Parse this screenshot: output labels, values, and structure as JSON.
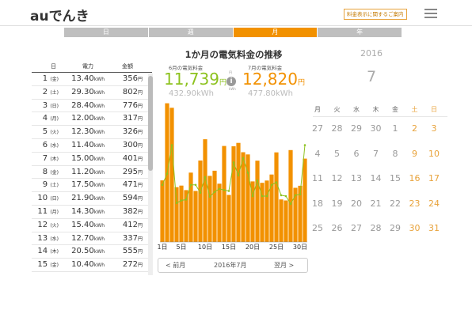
{
  "header": {
    "logo_au": "au",
    "logo_text": "でんき",
    "notice_label": "料金表示に関するご案内"
  },
  "tabs": [
    "日",
    "週",
    "月",
    "年"
  ],
  "table": {
    "headers": [
      "日",
      "電力",
      "金額"
    ],
    "rows": [
      {
        "day": "1",
        "wd": "(金)",
        "kwh": "13.40",
        "yen": "356"
      },
      {
        "day": "2",
        "wd": "(土)",
        "kwh": "29.30",
        "yen": "802"
      },
      {
        "day": "3",
        "wd": "(日)",
        "kwh": "28.40",
        "yen": "776"
      },
      {
        "day": "4",
        "wd": "(月)",
        "kwh": "12.00",
        "yen": "317"
      },
      {
        "day": "5",
        "wd": "(火)",
        "kwh": "12.30",
        "yen": "326"
      },
      {
        "day": "6",
        "wd": "(水)",
        "kwh": "11.40",
        "yen": "300"
      },
      {
        "day": "7",
        "wd": "(木)",
        "kwh": "15.00",
        "yen": "401"
      },
      {
        "day": "8",
        "wd": "(金)",
        "kwh": "11.20",
        "yen": "295"
      },
      {
        "day": "9",
        "wd": "(土)",
        "kwh": "17.50",
        "yen": "471"
      },
      {
        "day": "10",
        "wd": "(日)",
        "kwh": "21.90",
        "yen": "594"
      },
      {
        "day": "11",
        "wd": "(月)",
        "kwh": "14.30",
        "yen": "382"
      },
      {
        "day": "12",
        "wd": "(火)",
        "kwh": "15.40",
        "yen": "412"
      },
      {
        "day": "13",
        "wd": "(水)",
        "kwh": "12.70",
        "yen": "337"
      },
      {
        "day": "14",
        "wd": "(木)",
        "kwh": "20.50",
        "yen": "555"
      },
      {
        "day": "15",
        "wd": "(金)",
        "kwh": "10.40",
        "yen": "272"
      }
    ],
    "kwh_unit": "kWh",
    "yen_unit": "円"
  },
  "summary": {
    "title": "1か月の電気料金の推移",
    "prev_label": "6月の電気料金",
    "prev_amount": "11,739",
    "prev_kwh": "432.90kWh",
    "curr_label": "7月の電気料金",
    "curr_amount": "12,820",
    "curr_kwh": "477.80kWh",
    "yen_unit": "円",
    "side_yen": "円",
    "side_kwh": "kWh",
    "info_glyph": "i"
  },
  "chart_data": {
    "type": "bar",
    "x_tick_labels": [
      "1日",
      "5日",
      "10日",
      "15日",
      "20日",
      "25日",
      "30日"
    ],
    "x_tick_days": [
      1,
      5,
      10,
      15,
      20,
      25,
      30
    ],
    "series": [
      {
        "values": [
          356,
          802,
          776,
          317,
          326,
          300,
          401,
          295,
          471,
          594,
          382,
          412,
          337,
          555,
          272,
          553,
          573,
          519,
          506,
          350,
          470,
          342,
          355,
          390,
          518,
          246,
          240,
          531,
          313,
          325,
          482
        ]
      },
      {
        "values": [
          330,
          395,
          560,
          225,
          240,
          245,
          330,
          330,
          285,
          375,
          262,
          290,
          307,
          300,
          295,
          460,
          385,
          485,
          400,
          265,
          355,
          265,
          265,
          330,
          345,
          270,
          265,
          220,
          270,
          275,
          560
        ]
      }
    ],
    "ylim": [
      0,
      800
    ],
    "bar_color": "#f29100",
    "line_color": "#8dc21f"
  },
  "nav": {
    "prev": "<  前月",
    "current": "2016年7月",
    "next": "翌月  >"
  },
  "calendar": {
    "year": "2016",
    "month": "7",
    "weekdays": [
      "月",
      "火",
      "水",
      "木",
      "金",
      "土",
      "日"
    ],
    "weeks": [
      [
        "27",
        "28",
        "29",
        "30",
        "1",
        "2",
        "3"
      ],
      [
        "4",
        "5",
        "6",
        "7",
        "8",
        "9",
        "10"
      ],
      [
        "11",
        "12",
        "13",
        "14",
        "15",
        "16",
        "17"
      ],
      [
        "18",
        "19",
        "20",
        "21",
        "22",
        "23",
        "24"
      ],
      [
        "25",
        "26",
        "27",
        "28",
        "29",
        "30",
        "31"
      ]
    ]
  }
}
